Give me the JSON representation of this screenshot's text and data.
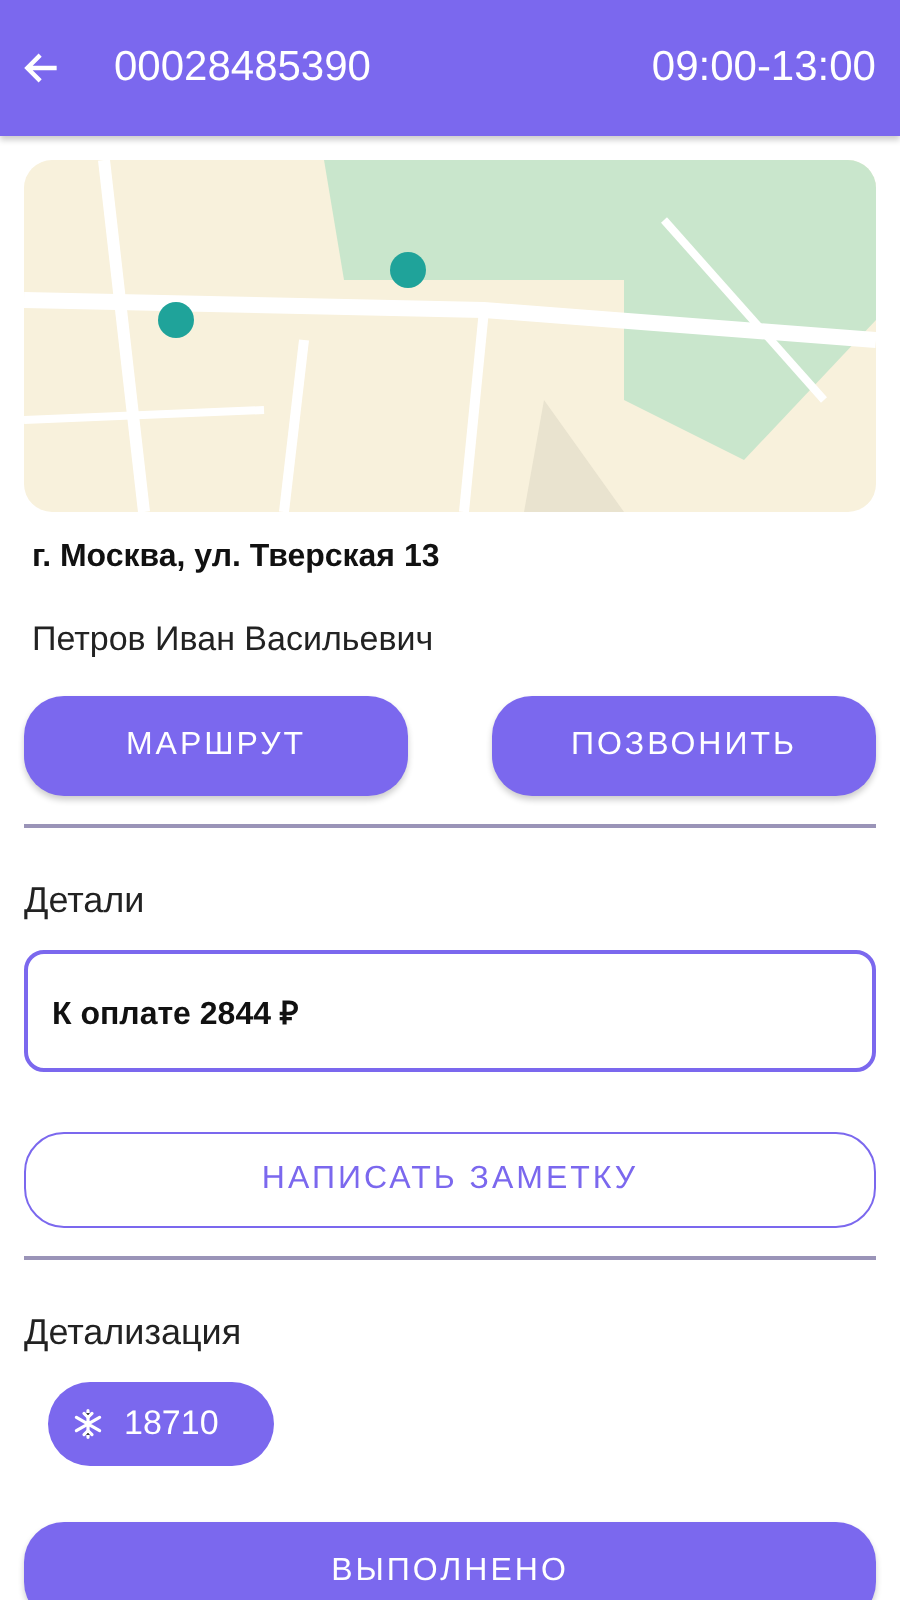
{
  "header": {
    "order_number": "00028485390",
    "time_window": "09:00-13:00"
  },
  "address": "г. Москва, ул. Тверская 13",
  "customer": "Петров Иван Васильевич",
  "actions": [
    "МАРШРУТ",
    "ПОЗВОНИТЬ"
  ],
  "details": {
    "title": "Детали",
    "payment": "К оплате 2844 ₽"
  },
  "note_button": "НАПИСАТЬ ЗАМЕТКУ",
  "breakdown": {
    "title": "Детализация",
    "chips": [
      {
        "label": "18710"
      }
    ]
  },
  "done_button": "ВЫПОЛНЕНО"
}
